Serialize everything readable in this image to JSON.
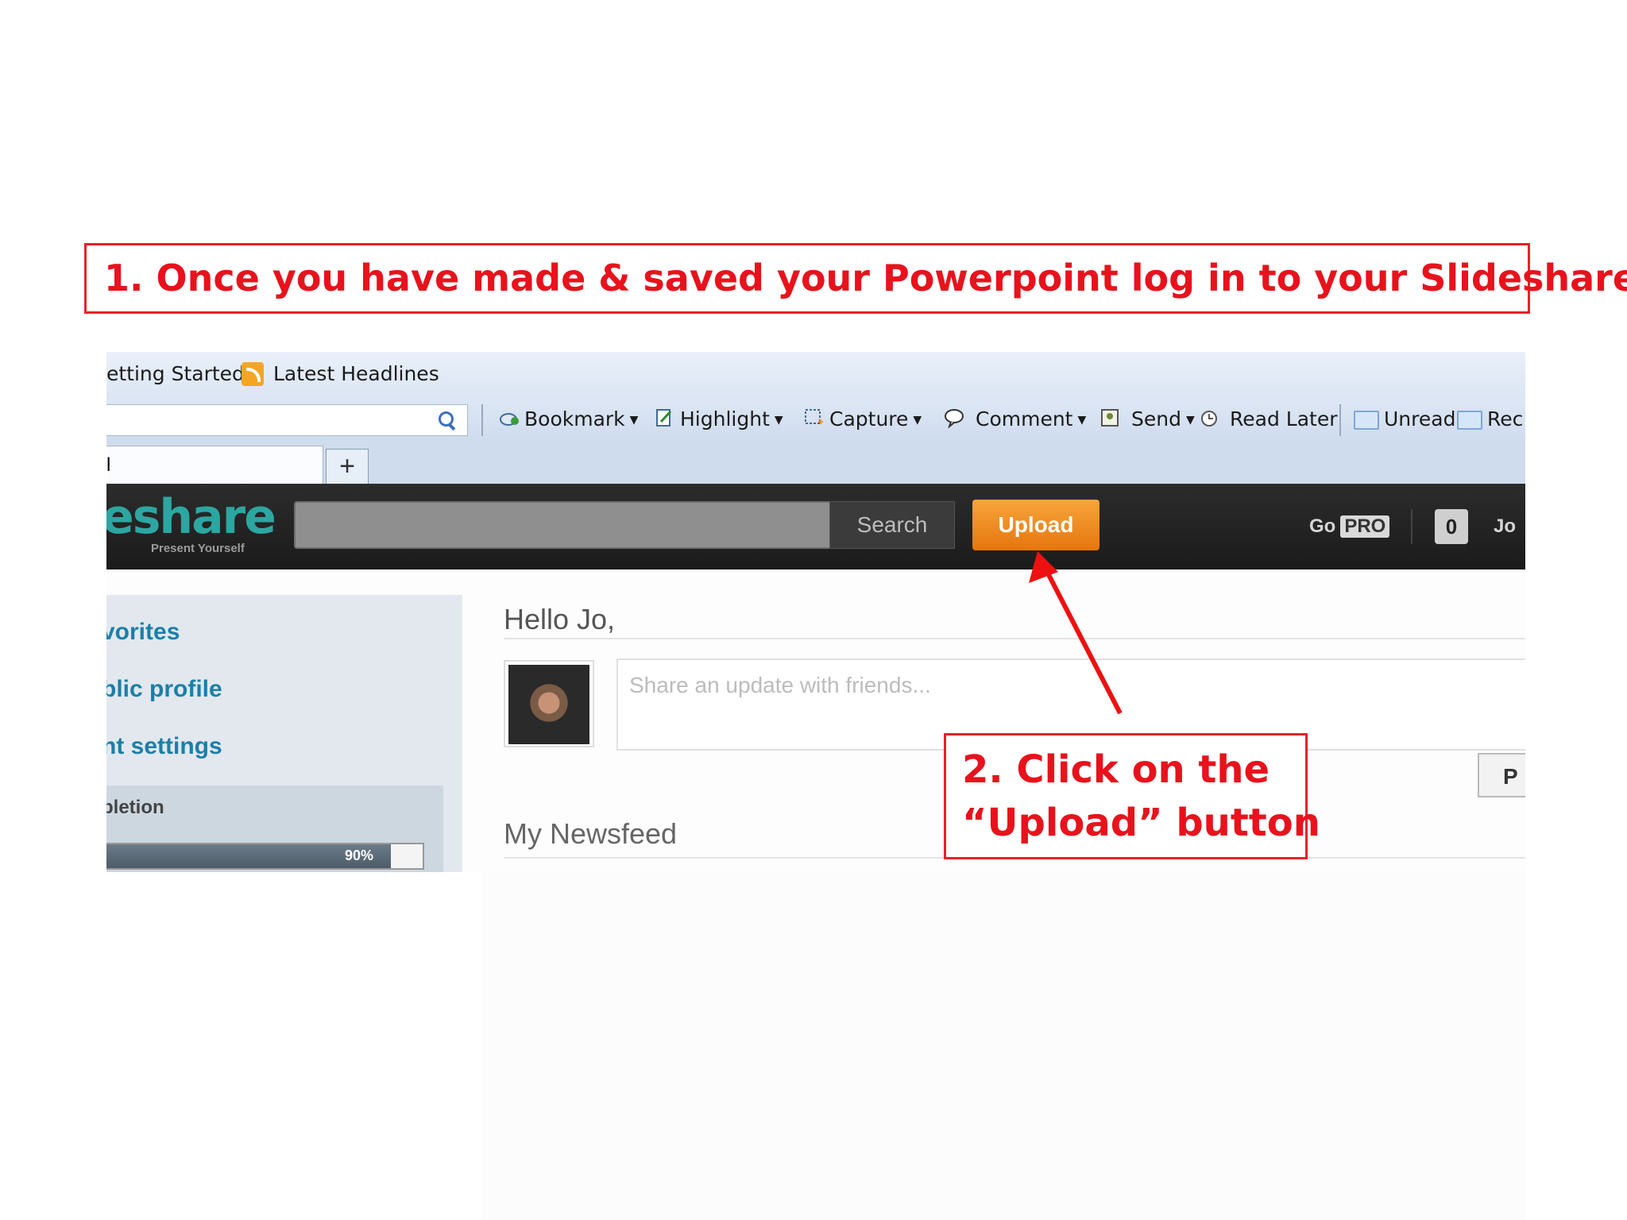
{
  "callouts": {
    "step1": "1. Once you have made & saved your Powerpoint log in to your Slideshare",
    "step2_line1": "2. Click on the",
    "step2_line2": "“Upload” button"
  },
  "colors": {
    "annotation_red": "#e8121c",
    "upload_orange": "#f39425",
    "brand_teal": "#2ca6a1",
    "navbar": "#222222"
  },
  "bookmarks_bar": {
    "items": [
      "etting Started",
      "Latest Headlines"
    ]
  },
  "toolbar": {
    "bookmark": "Bookmark",
    "highlight": "Highlight",
    "capture": "Capture",
    "comment": "Comment",
    "send": "Send",
    "read_later": "Read Later",
    "unread": "Unread",
    "rec": "Rec"
  },
  "tab": {
    "label": "l",
    "new_tab": "+"
  },
  "navbar": {
    "logo": "eshare",
    "tagline": "Present Yourself",
    "search_button": "Search",
    "upload_button": "Upload",
    "go_label": "Go",
    "pro_badge": "PRO",
    "notifications": "0",
    "username": "Jo"
  },
  "sidebar": {
    "links": [
      "vorites",
      "blic profile",
      "nt settings"
    ],
    "completion_label": "pletion",
    "progress_text": "90%",
    "progress_fraction": 0.9
  },
  "main": {
    "greeting": "Hello Jo,",
    "update_placeholder": "Share an update with friends...",
    "post_button": "P",
    "newsfeed": "My Newsfeed"
  }
}
